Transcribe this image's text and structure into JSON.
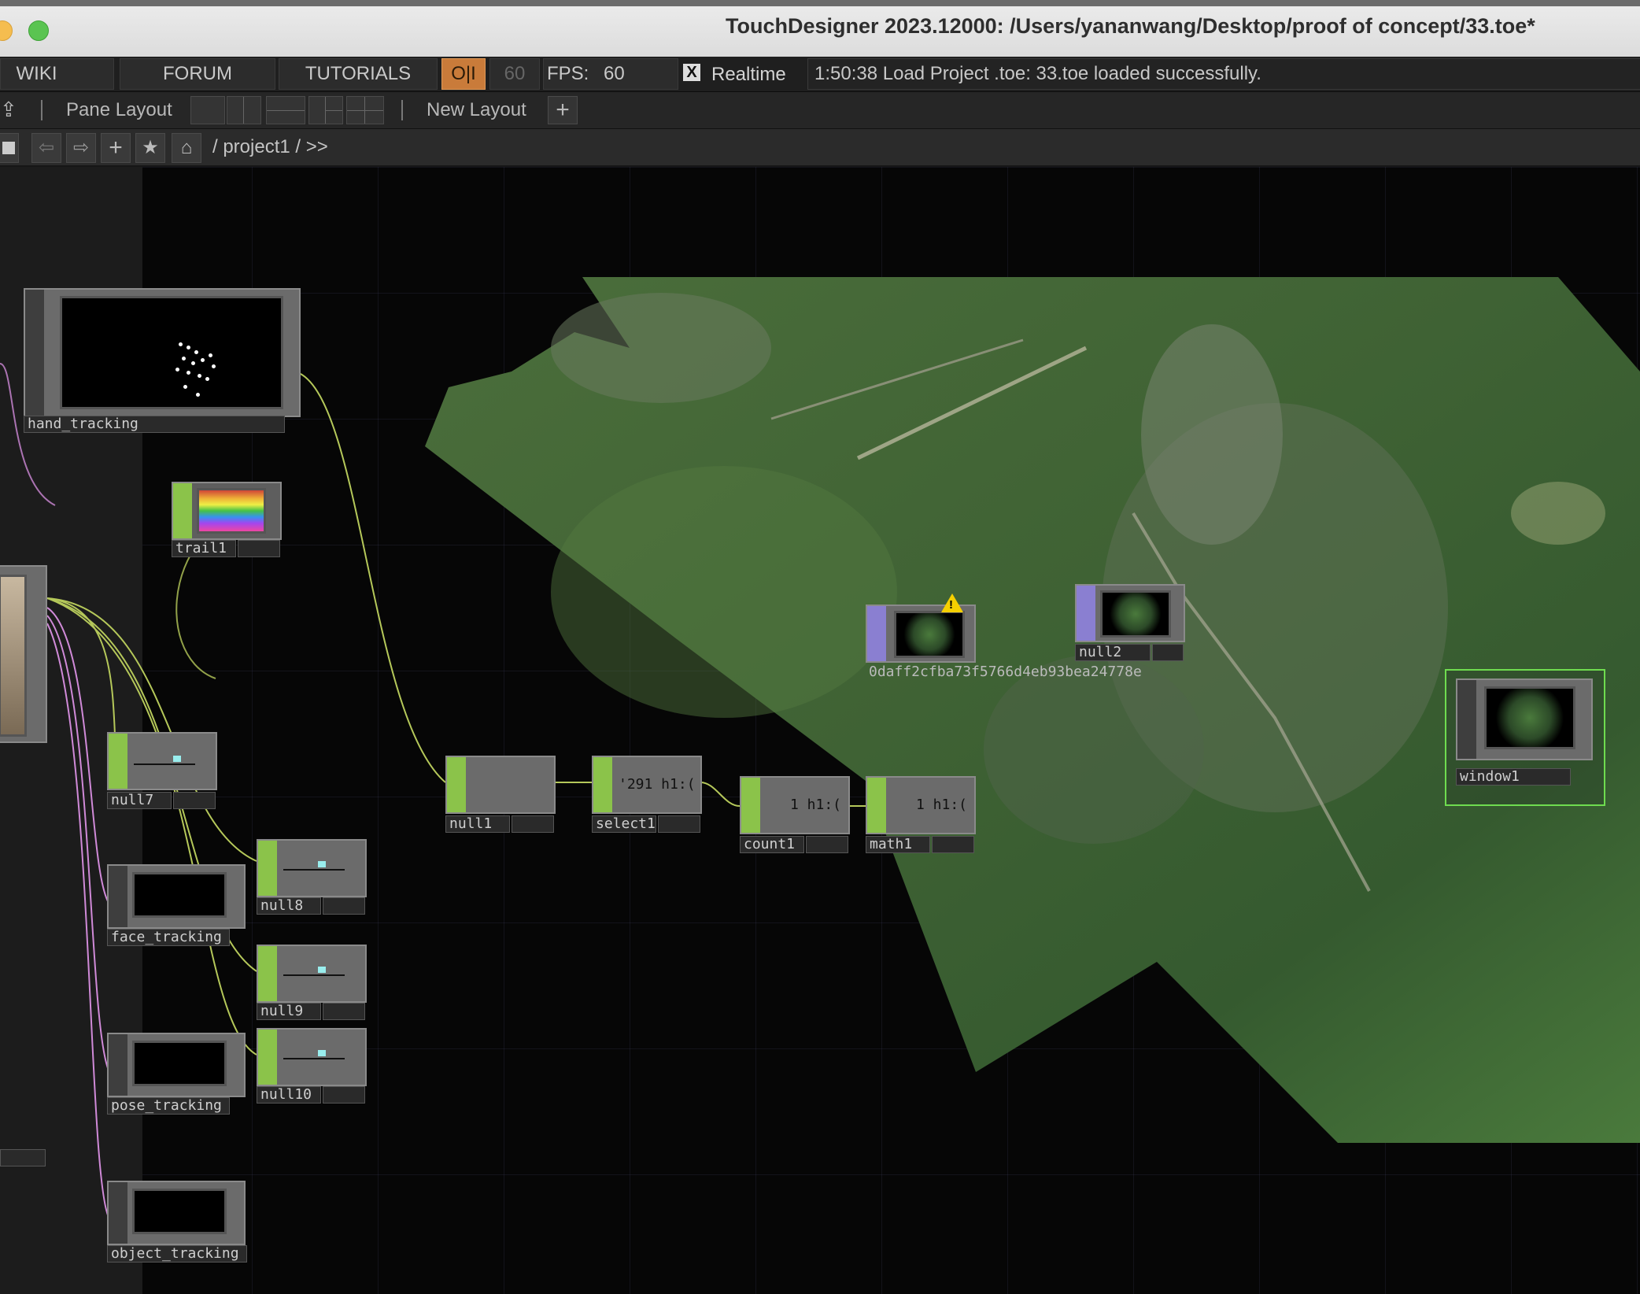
{
  "window": {
    "title": "TouchDesigner 2023.12000: /Users/yananwang/Desktop/proof of concept/33.toe*"
  },
  "menubar": {
    "wiki": "WIKI",
    "forum": "FORUM",
    "tutorials": "TUTORIALS",
    "oi_toggle": "O|I",
    "fps_dim": "60",
    "fps_label": "FPS:",
    "fps_value": "60",
    "realtime_check": "X",
    "realtime_label": "Realtime",
    "status": "1:50:38 Load Project .toe: 33.toe loaded successfully."
  },
  "toolbar": {
    "pane_layout": "Pane Layout",
    "new_layout": "New Layout",
    "add": "+"
  },
  "pathbar": {
    "path": "/ project1 / >>"
  },
  "nodes": {
    "hand_tracking": "hand_tracking",
    "trail1": "trail1",
    "null7": "null7",
    "null8": "null8",
    "null9": "null9",
    "null10": "null10",
    "face_tracking": "face_tracking",
    "pose_tracking": "pose_tracking",
    "object_tracking": "object_tracking",
    "null1": "null1",
    "select1": "select1",
    "select1_value": "'291 h1:(",
    "count1": "count1",
    "count1_value": "1 h1:(",
    "math1": "math1",
    "math1_value": "1 h1:(",
    "hash_node": "0daff2cfba73f5766d4eb93bea24778e",
    "null2": "null2",
    "window1": "window1"
  },
  "colors": {
    "accent_orange": "#c97b3a",
    "chop_green": "#8bc34a",
    "top_purple": "#8a7fd1",
    "selected_green": "#6fdc4f",
    "warning_yellow": "#f5d000"
  }
}
